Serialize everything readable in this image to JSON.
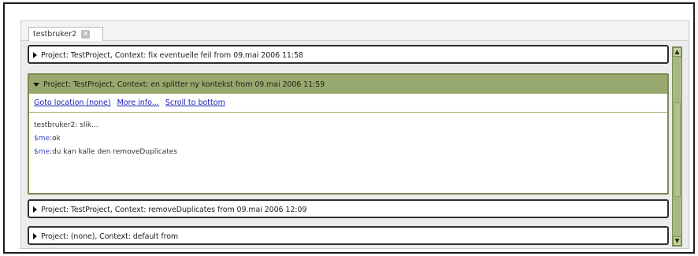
{
  "tab": {
    "title": "testbruker2",
    "close_symbol": "×"
  },
  "sessions": [
    {
      "state": "collapsed",
      "header": "Project: TestProject, Context: fix eventuelle feil from 09.mai 2006 11:58"
    },
    {
      "state": "expanded",
      "header": "Project: TestProject, Context: en splitter ny kontekst from 09.mai 2006 11:59",
      "links": [
        "Goto location (none)",
        "More info...",
        "Scroll to bottom"
      ],
      "messages": [
        {
          "sender": "",
          "text": "testbruker2: slik..."
        },
        {
          "sender": "$me:",
          "text": "ok"
        },
        {
          "sender": "$me:",
          "text": "du kan kalle den removeDuplicates"
        }
      ]
    },
    {
      "state": "collapsed",
      "header": "Project: TestProject, Context: removeDuplicates from 09.mai 2006 12:09"
    },
    {
      "state": "collapsed",
      "header": "Project: (none), Context: default from"
    }
  ],
  "scrollbar": {
    "up_icon": "up-arrow-icon",
    "down_icon": "down-arrow-icon"
  },
  "colors": {
    "accent": "#98a96f",
    "link": "#1b1bb8",
    "me_label": "#3b49b7"
  }
}
